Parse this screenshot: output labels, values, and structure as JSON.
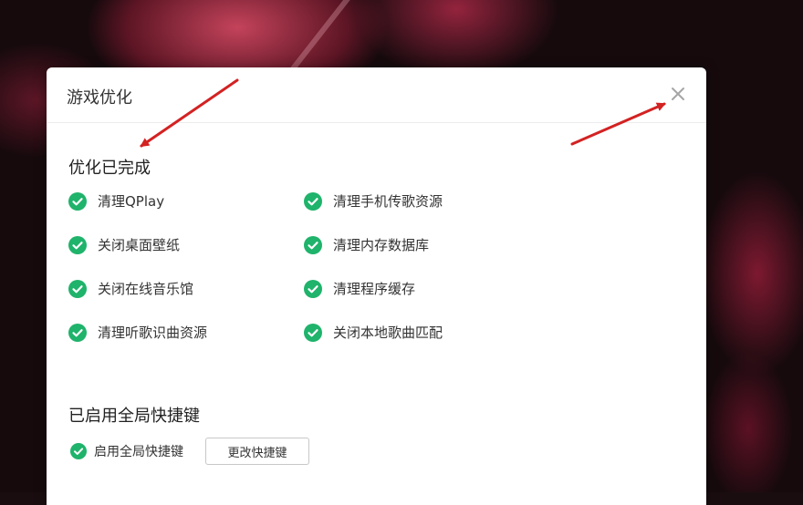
{
  "dialog": {
    "title": "游戏优化",
    "close_icon": "close-icon"
  },
  "optimization": {
    "heading": "优化已完成",
    "items_left": [
      "清理QPlay",
      "关闭桌面壁纸",
      "关闭在线音乐馆",
      "清理听歌识曲资源"
    ],
    "items_right": [
      "清理手机传歌资源",
      "清理内存数据库",
      "清理程序缓存",
      "关闭本地歌曲匹配"
    ]
  },
  "shortcut": {
    "heading": "已启用全局快捷键",
    "checkbox_label": "启用全局快捷键",
    "change_button": "更改快捷键"
  },
  "colors": {
    "check_green": "#1fb36b",
    "annotation_arrow": "#d32222"
  }
}
